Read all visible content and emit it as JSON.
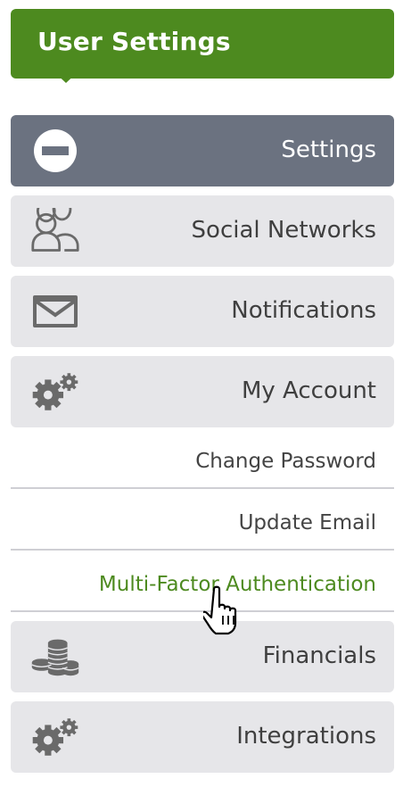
{
  "header": {
    "title": "User Settings"
  },
  "menu": {
    "items": [
      {
        "label": "Settings",
        "icon": "minus-circle-icon",
        "active": true
      },
      {
        "label": "Social Networks",
        "icon": "users-icon"
      },
      {
        "label": "Notifications",
        "icon": "envelope-icon"
      },
      {
        "label": "My Account",
        "icon": "gears-icon"
      }
    ],
    "subitems": [
      {
        "label": "Change Password"
      },
      {
        "label": "Update Email"
      },
      {
        "label": "Multi-Factor Authentication",
        "selected": true
      }
    ],
    "items_after": [
      {
        "label": "Financials",
        "icon": "coins-icon"
      },
      {
        "label": "Integrations",
        "icon": "gears-icon"
      }
    ]
  },
  "colors": {
    "brand_green": "#4d8a1f",
    "active_item_bg": "#6b7280",
    "item_bg": "#e6e6e9",
    "icon_gray": "#6a6a6a"
  },
  "cursor": {
    "icon": "hand-pointer-cursor-icon"
  }
}
